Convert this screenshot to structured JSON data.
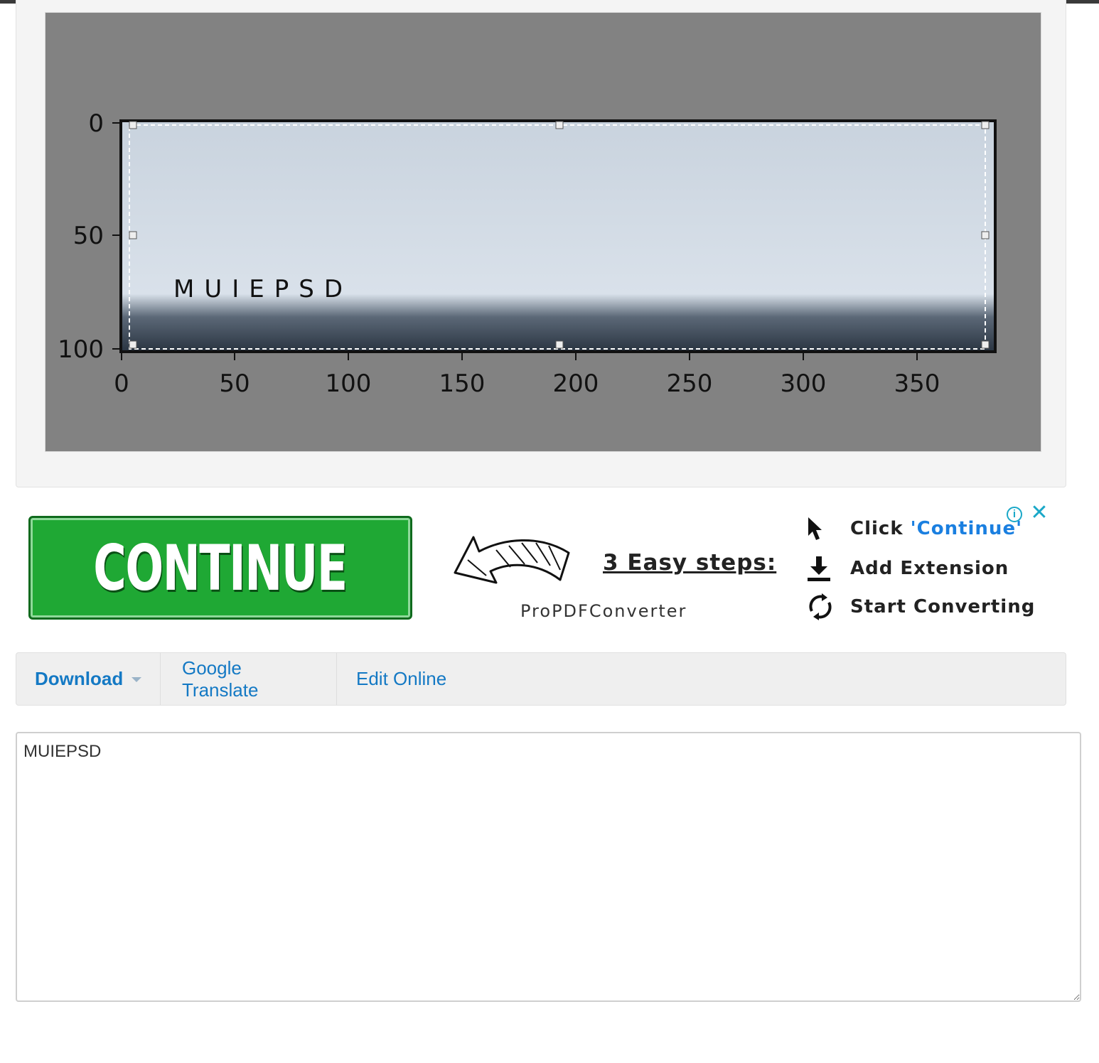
{
  "preview": {
    "y_ticks": [
      "0",
      "50",
      "100"
    ],
    "x_ticks": [
      "0",
      "50",
      "100",
      "150",
      "200",
      "250",
      "300",
      "350"
    ],
    "plate_text": "MUIEPSD"
  },
  "ad": {
    "button_label": "CONTINUE",
    "steps_title": "3 Easy steps:",
    "brand": "ProPDFConverter",
    "steps": [
      {
        "prefix": "Click ",
        "accent": "'Continue'",
        "icon": "cursor-icon"
      },
      {
        "prefix": "Add Extension",
        "accent": "",
        "icon": "download-icon"
      },
      {
        "prefix": "Start Converting",
        "accent": "",
        "icon": "refresh-icon"
      }
    ],
    "info_glyph": "i",
    "close_glyph": "✕",
    "colors": {
      "button": "#1fa834",
      "accent": "#1a7fe0",
      "adchoices": "#1aa8c8"
    }
  },
  "toolbar": {
    "download_label": "Download",
    "translate_label": "Google Translate",
    "edit_label": "Edit Online",
    "link_color": "#1479c4"
  },
  "result": {
    "text": "MUIEPSD"
  }
}
